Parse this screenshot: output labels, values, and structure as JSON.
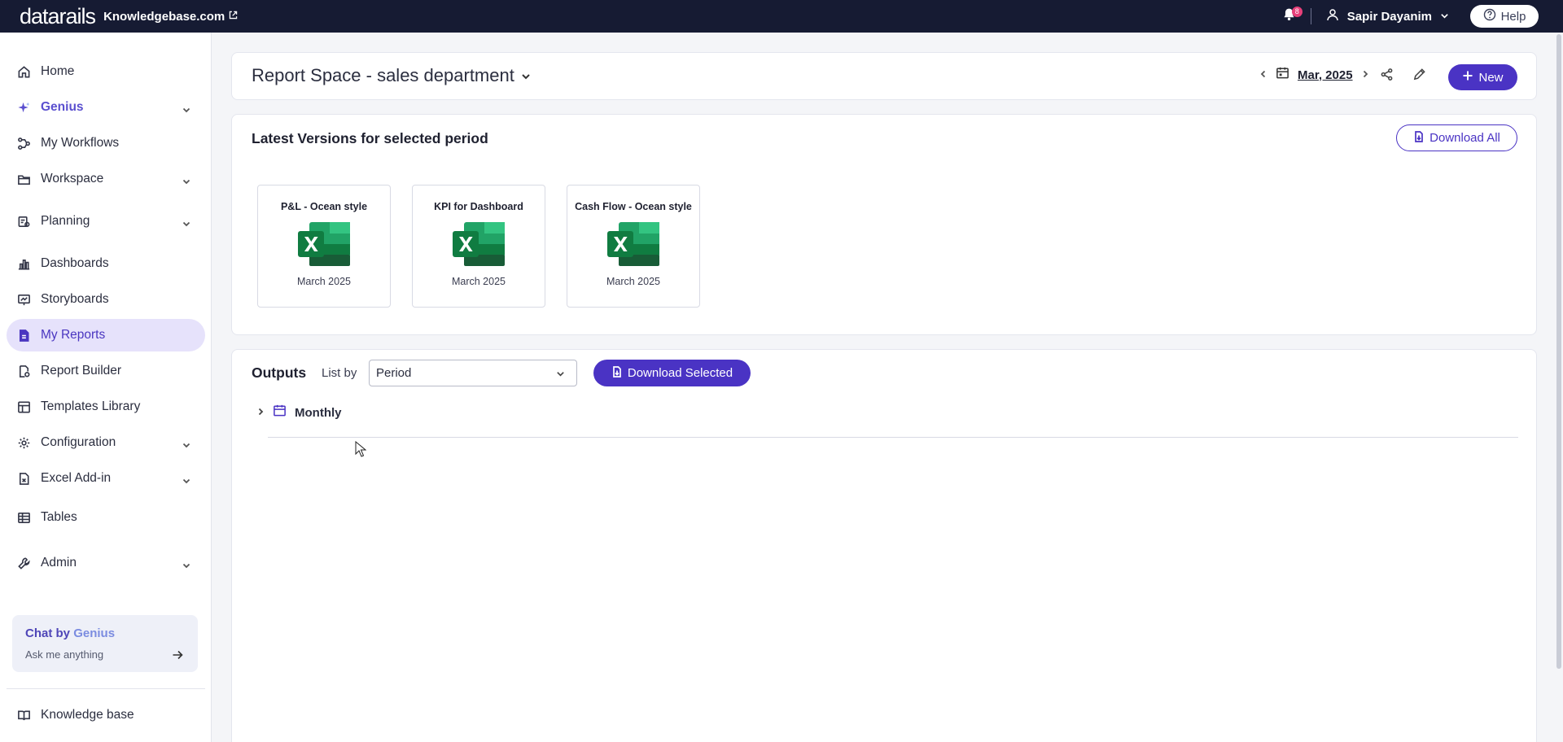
{
  "topbar": {
    "logo": "datarails",
    "workspace_link": "Knowledgebase.com",
    "notification_count": "8",
    "user_name": "Sapir Dayanim",
    "help_label": "Help"
  },
  "sidebar": {
    "items": [
      {
        "label": "Home",
        "icon": "home-icon"
      },
      {
        "label": "Genius",
        "icon": "sparkle-icon"
      },
      {
        "label": "My Workflows",
        "icon": "workflow-icon"
      },
      {
        "label": "Workspace",
        "icon": "folder-icon"
      },
      {
        "label": "Planning",
        "icon": "planning-icon"
      },
      {
        "label": "Dashboards",
        "icon": "bar-chart-icon"
      },
      {
        "label": "Storyboards",
        "icon": "presentation-icon"
      },
      {
        "label": "My Reports",
        "icon": "report-icon"
      },
      {
        "label": "Report Builder",
        "icon": "report-builder-icon"
      },
      {
        "label": "Templates Library",
        "icon": "template-icon"
      },
      {
        "label": "Configuration",
        "icon": "gear-icon"
      },
      {
        "label": "Excel Add-in",
        "icon": "excel-file-icon"
      },
      {
        "label": "Tables",
        "icon": "table-icon"
      },
      {
        "label": "Admin",
        "icon": "wrench-icon"
      },
      {
        "label": "Knowledge base",
        "icon": "book-icon"
      }
    ],
    "chat": {
      "title_prefix": "Chat by",
      "title_brand": "Genius",
      "subtitle": "Ask me anything"
    }
  },
  "header": {
    "title": "Report Space - sales department",
    "period": "Mar, 2025",
    "new_label": "New"
  },
  "versions": {
    "title": "Latest Versions for selected period",
    "download_all_label": "Download All",
    "files": [
      {
        "name": "P&L - Ocean style",
        "date": "March 2025"
      },
      {
        "name": "KPI for Dashboard",
        "date": "March 2025"
      },
      {
        "name": "Cash Flow - Ocean style",
        "date": "March 2025"
      }
    ]
  },
  "outputs": {
    "title": "Outputs",
    "list_by_label": "List by",
    "list_by_value": "Period",
    "download_selected_label": "Download Selected",
    "groups": [
      {
        "label": "Monthly"
      }
    ]
  },
  "colors": {
    "topbar": "#161b33",
    "accent": "#4a33c4",
    "active_nav_bg": "#e6e2fb",
    "excel_green": "#1f7a45"
  }
}
